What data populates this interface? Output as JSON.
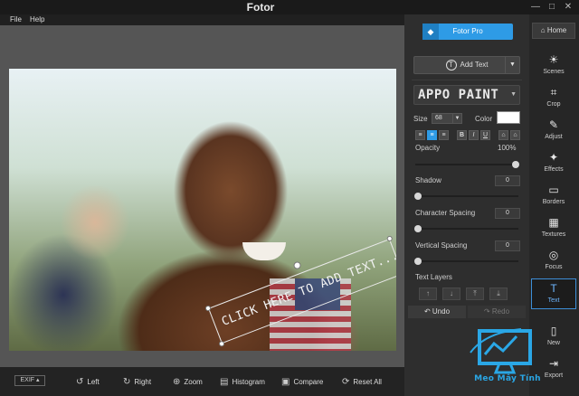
{
  "window": {
    "title": "Fotor",
    "minimize": "—",
    "maximize": "□",
    "close": "✕"
  },
  "menu": {
    "file": "File",
    "help": "Help"
  },
  "canvas": {
    "overlay_text": "CLICK HERE TO ADD TEXT..."
  },
  "bottombar": {
    "exif": "EXIF ▴",
    "tools": [
      "Left",
      "Right",
      "Zoom",
      "Histogram",
      "Compare",
      "Reset All"
    ]
  },
  "panel": {
    "pro_label": "Fotor Pro",
    "add_text_label": "Add Text",
    "font_name": "APPO PAINT",
    "size_label": "Size",
    "size_value": "68",
    "color_label": "Color",
    "color_value": "#ffffff",
    "format_buttons": [
      "≡",
      "≡",
      "≡",
      "B",
      "I",
      "U",
      "⌂",
      "⌂"
    ],
    "opacity_label": "Opacity",
    "opacity_value": "100%",
    "opacity_level": 1.0,
    "shadow_label": "Shadow",
    "shadow_value": "0",
    "char_spacing_label": "Character Spacing",
    "char_spacing_value": "0",
    "vert_spacing_label": "Vertical Spacing",
    "vert_spacing_value": "0",
    "text_layers_label": "Text Layers",
    "undo_label": "↶ Undo",
    "redo_label": "↷ Redo"
  },
  "rail": {
    "home_label": "Home",
    "tools": [
      "Scenes",
      "Crop",
      "Adjust",
      "Effects",
      "Borders",
      "Textures",
      "Focus",
      "Text",
      "New",
      "Export"
    ]
  },
  "watermark": {
    "text": "Meo Mây Tính"
  },
  "colors": {
    "accent": "#2e9be6",
    "panel_bg": "#2e2e2e",
    "canvas_bg": "#555555"
  }
}
